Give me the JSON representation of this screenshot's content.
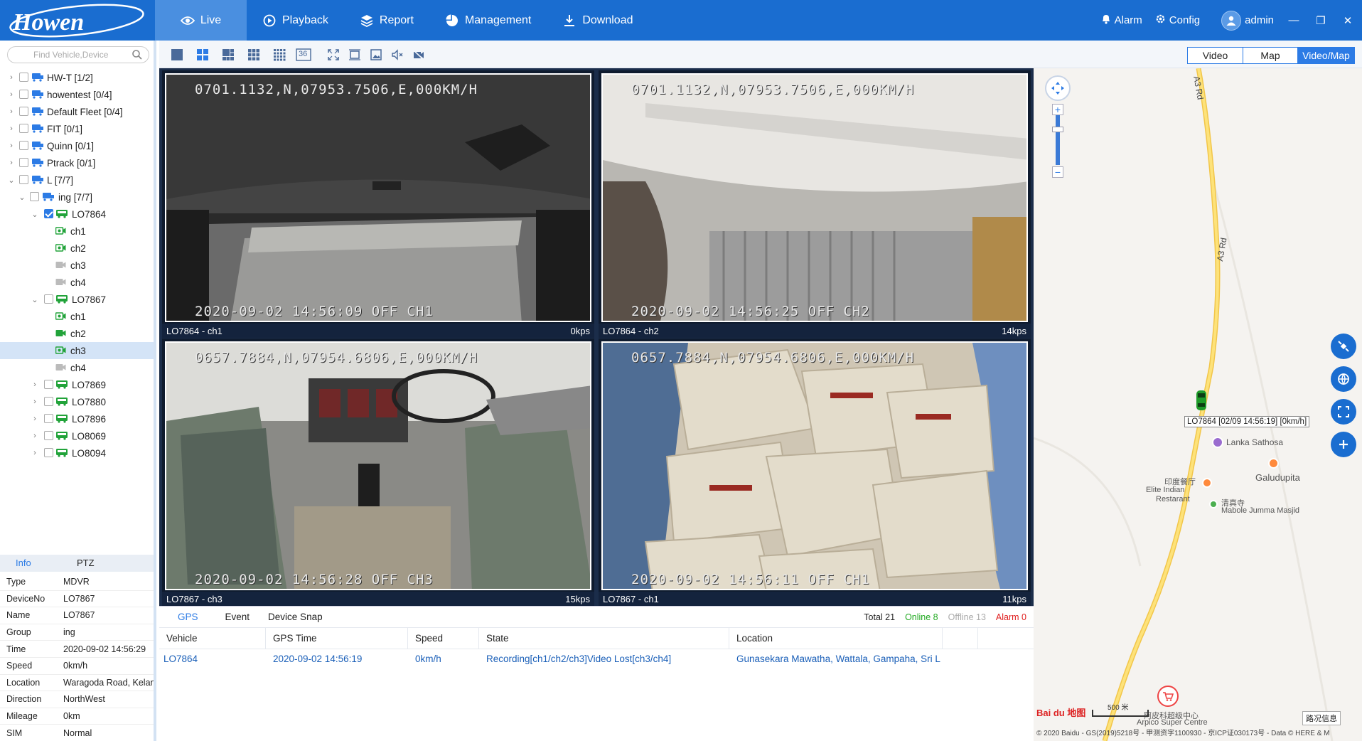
{
  "app": {
    "logo_text": "Howen",
    "nav": [
      {
        "label": "Live",
        "icon": "eye-icon"
      },
      {
        "label": "Playback",
        "icon": "play-icon"
      },
      {
        "label": "Report",
        "icon": "layers-icon"
      },
      {
        "label": "Management",
        "icon": "pie-icon"
      },
      {
        "label": "Download",
        "icon": "download-icon"
      }
    ],
    "alarm_label": "Alarm",
    "config_label": "Config",
    "user_label": "admin"
  },
  "sidebar": {
    "search_placeholder": "Find Vehicle,Device",
    "tree": [
      {
        "label": "HW-T",
        "count": "[1/2]"
      },
      {
        "label": "howentest",
        "count": "[0/4]"
      },
      {
        "label": "Default Fleet",
        "count": "[0/4]"
      },
      {
        "label": "FIT",
        "count": "[0/1]"
      },
      {
        "label": "Quinn",
        "count": "[0/1]"
      },
      {
        "label": "Ptrack",
        "count": "[0/1]"
      },
      {
        "label": "L",
        "count": "[7/7]"
      },
      {
        "label": "ing",
        "count": "[7/7]"
      },
      {
        "label": "LO7864"
      },
      {
        "label": "ch1"
      },
      {
        "label": "ch2"
      },
      {
        "label": "ch3"
      },
      {
        "label": "ch4"
      },
      {
        "label": "LO7867"
      },
      {
        "label": "ch1"
      },
      {
        "label": "ch2"
      },
      {
        "label": "ch3"
      },
      {
        "label": "ch4"
      },
      {
        "label": "LO7869"
      },
      {
        "label": "LO7880"
      },
      {
        "label": "LO7896"
      },
      {
        "label": "LO8069"
      },
      {
        "label": "LO8094"
      }
    ],
    "info_tabs": [
      "Info",
      "PTZ"
    ],
    "info": [
      {
        "key": "Type",
        "value": "MDVR"
      },
      {
        "key": "DeviceNo",
        "value": "LO7867"
      },
      {
        "key": "Name",
        "value": "LO7867"
      },
      {
        "key": "Group",
        "value": "ing"
      },
      {
        "key": "Time",
        "value": "2020-09-02 14:56:29"
      },
      {
        "key": "Speed",
        "value": "0km/h"
      },
      {
        "key": "Location",
        "value": "Waragoda Road, Kelaniya"
      },
      {
        "key": "Direction",
        "value": "NorthWest"
      },
      {
        "key": "Mileage",
        "value": "0km"
      },
      {
        "key": "SIM",
        "value": "Normal"
      }
    ]
  },
  "toolbar": {
    "grid36_label": "36",
    "views": [
      "Video",
      "Map",
      "Video/Map"
    ],
    "active_view": "Video/Map"
  },
  "videos": [
    {
      "title": "LO7864 - ch1",
      "rate": "0kps",
      "osd_top": "0701.1132,N,07953.7506,E,000KM/H",
      "osd_bottom": "2020-09-02 14:56:09  OFF CH1"
    },
    {
      "title": "LO7864 - ch2",
      "rate": "14kps",
      "osd_top": "0701.1132,N,07953.7506,E,000KM/H",
      "osd_bottom": "2020-09-02 14:56:25  OFF CH2"
    },
    {
      "title": "LO7867 - ch3",
      "rate": "15kps",
      "osd_top": "0657.7884,N,07954.6806,E,000KM/H",
      "osd_bottom": "2020-09-02 14:56:28  OFF CH3"
    },
    {
      "title": "LO7867 - ch1",
      "rate": "11kps",
      "osd_top": "0657.7884,N,07954.6806,E,000KM/H",
      "osd_bottom": "2020-09-02 14:56:11  OFF CH1"
    }
  ],
  "bottom": {
    "tabs": [
      "GPS",
      "Event",
      "Device Snap"
    ],
    "stats": {
      "total": "Total 21",
      "online": "Online 8",
      "offline": "Offline 13",
      "alarm": "Alarm 0"
    },
    "colors": {
      "online": "#22aa22",
      "offline": "#aaaaaa",
      "alarm": "#e02020"
    },
    "columns": [
      "Vehicle",
      "GPS Time",
      "Speed",
      "State",
      "Location"
    ],
    "rows": [
      {
        "vehicle": "LO7864",
        "gps_time": "2020-09-02 14:56:19",
        "speed": "0km/h",
        "state": "Recording[ch1/ch2/ch3]Video Lost[ch3/ch4]",
        "location": "Gunasekara Mawatha, Wattala, Gampaha, Sri L"
      }
    ]
  },
  "map": {
    "road_label_1": "A3 Rd",
    "road_label_2": "A3 Rd",
    "car_label": "LO7864 [02/09 14:56:19] [0km/h]",
    "poi": [
      {
        "label": "Lanka Sathosa"
      },
      {
        "label": "Galudupita"
      },
      {
        "label": "印度餐厅"
      },
      {
        "label": "Elite Indian"
      },
      {
        "label": "Restarant"
      },
      {
        "label": "清真寺"
      },
      {
        "label": "Mabole Jumma Masjid"
      },
      {
        "label": "阿皮科超级中心"
      },
      {
        "label": "Arpico Super Centre"
      }
    ],
    "scale_label": "500 米",
    "copyright": "© 2020 Baidu - GS(2019)5218号 - 甲测资字1100930 - 京ICP证030173号 - Data © HERE & M",
    "traffic_label": "路况信息",
    "baidu_logo": "Bai du 地图"
  }
}
